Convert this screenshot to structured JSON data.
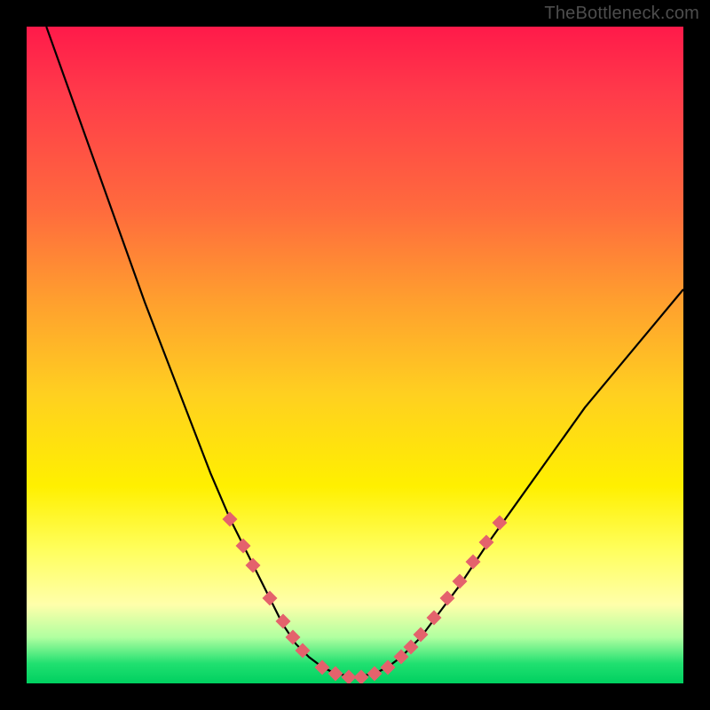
{
  "watermark": "TheBottleneck.com",
  "chart_data": {
    "type": "line",
    "title": "",
    "xlabel": "",
    "ylabel": "",
    "xlim": [
      0,
      100
    ],
    "ylim": [
      0,
      100
    ],
    "grid": false,
    "legend": false,
    "series": [
      {
        "name": "bottleneck-curve",
        "x": [
          3,
          8,
          13,
          18,
          23,
          28,
          31,
          34,
          37,
          39,
          41,
          43,
          45,
          47,
          50,
          53,
          55,
          57,
          60,
          63,
          66,
          70,
          75,
          80,
          85,
          90,
          95,
          100
        ],
        "y": [
          100,
          86,
          72,
          58,
          45,
          32,
          25,
          19,
          13,
          9,
          6,
          4,
          2.5,
          1.5,
          1,
          1.5,
          2.5,
          4,
          7,
          11,
          15,
          21,
          28,
          35,
          42,
          48,
          54,
          60
        ]
      }
    ],
    "markers": {
      "name": "highlight-dots",
      "color": "#e4626c",
      "points": [
        {
          "x": 31,
          "y": 25
        },
        {
          "x": 33,
          "y": 21
        },
        {
          "x": 34.5,
          "y": 18
        },
        {
          "x": 37,
          "y": 13
        },
        {
          "x": 39,
          "y": 9.5
        },
        {
          "x": 40.5,
          "y": 7
        },
        {
          "x": 42,
          "y": 5
        },
        {
          "x": 45,
          "y": 2.5
        },
        {
          "x": 47,
          "y": 1.5
        },
        {
          "x": 49,
          "y": 1
        },
        {
          "x": 51,
          "y": 1
        },
        {
          "x": 53,
          "y": 1.5
        },
        {
          "x": 55,
          "y": 2.5
        },
        {
          "x": 57,
          "y": 4
        },
        {
          "x": 58.5,
          "y": 5.5
        },
        {
          "x": 60,
          "y": 7.5
        },
        {
          "x": 62,
          "y": 10
        },
        {
          "x": 64,
          "y": 13
        },
        {
          "x": 66,
          "y": 15.5
        },
        {
          "x": 68,
          "y": 18.5
        },
        {
          "x": 70,
          "y": 21.5
        },
        {
          "x": 72,
          "y": 24.5
        }
      ]
    },
    "background": {
      "type": "vertical-gradient",
      "stops": [
        {
          "pos": 0,
          "color": "#ff1a4a"
        },
        {
          "pos": 0.28,
          "color": "#ff6b3d"
        },
        {
          "pos": 0.56,
          "color": "#ffd020"
        },
        {
          "pos": 0.8,
          "color": "#ffff60"
        },
        {
          "pos": 0.97,
          "color": "#20e070"
        },
        {
          "pos": 1.0,
          "color": "#00d060"
        }
      ]
    }
  }
}
